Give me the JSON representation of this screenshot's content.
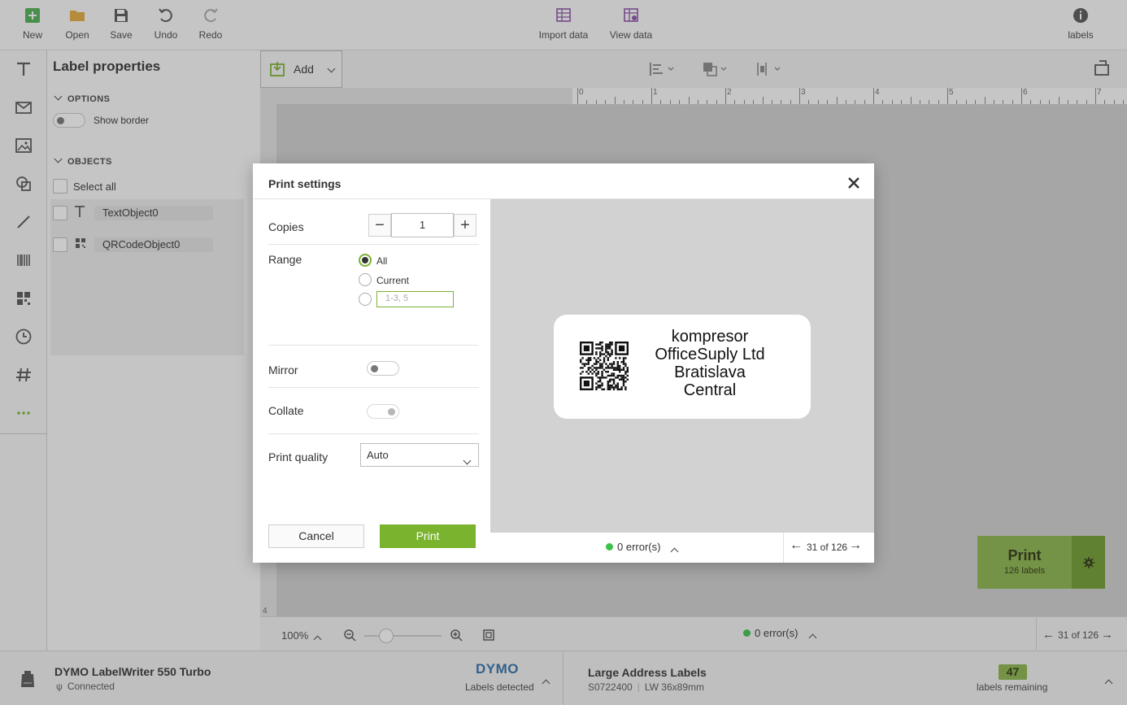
{
  "toolbar": {
    "new_label": "New",
    "open_label": "Open",
    "save_label": "Save",
    "undo_label": "Undo",
    "redo_label": "Redo",
    "import_label": "Import data",
    "view_label": "View data",
    "info_label": "labels"
  },
  "panel": {
    "title": "Label properties",
    "options_header": "OPTIONS",
    "show_border_label": "Show border",
    "objects_header": "OBJECTS",
    "select_all_label": "Select all",
    "objects": [
      "TextObject0",
      "QRCodeObject0"
    ]
  },
  "canvas": {
    "add_label": "Add",
    "ruler_ticks": [
      "0",
      "1",
      "2",
      "3",
      "4",
      "5",
      "6",
      "7"
    ],
    "vruler_tick": "4",
    "zoom": "100%",
    "errors": "0 error(s)",
    "page_nav": "31 of 126"
  },
  "float_print": {
    "label": "Print",
    "sub": "126 labels"
  },
  "statusbar": {
    "printer_name": "DYMO LabelWriter 550 Turbo",
    "printer_status": "Connected",
    "brand": "DYMO",
    "labels_detected": "Labels detected",
    "label_type": "Large Address Labels",
    "label_code": "S0722400",
    "label_size": "LW 36x89mm",
    "remaining_count": "47",
    "remaining_label": "labels remaining"
  },
  "dialog": {
    "title": "Print settings",
    "copies_label": "Copies",
    "copies_value": "1",
    "range_label": "Range",
    "range_all": "All",
    "range_current": "Current",
    "range_placeholder": "1-3, 5",
    "mirror_label": "Mirror",
    "collate_label": "Collate",
    "quality_label": "Print quality",
    "quality_value": "Auto",
    "cancel_label": "Cancel",
    "print_label": "Print",
    "errors": "0 error(s)",
    "page_nav": "31 of 126",
    "preview_lines": [
      "kompresor",
      "OfficeSuply Ltd",
      "Bratislava",
      "Central"
    ]
  },
  "colors": {
    "accent": "#7ab32e",
    "purple": "#8b4fa8",
    "folder": "#e4a93c",
    "new_icon": "#4caf50"
  }
}
